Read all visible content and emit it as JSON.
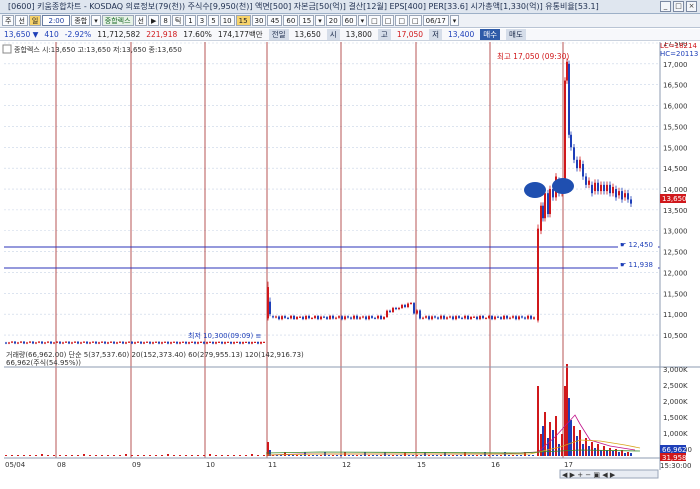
{
  "window": {
    "title": "[0600] 키움종합차트 - KOSDAQ 의료정보(79(천)) 주식수[9,950(천)] 액면[500] 자본금[50(억)] 결산[12월] EPS[400] PER[33.6] 시가총액[1,330(억)] 유통비율[53.1]",
    "buttons": [
      "_",
      "□",
      "×"
    ]
  },
  "toolbar": {
    "items": [
      "주",
      "선",
      "일",
      "종합",
      "▾",
      "중합렉스",
      "선",
      "▶",
      "8",
      "틱",
      "1",
      "3",
      "5",
      "10",
      "15",
      "30",
      "45",
      "60",
      "15",
      "▾",
      "20",
      "60",
      "▾",
      "",
      "",
      "",
      "",
      "06/17",
      "▾"
    ],
    "code_value": "2:00",
    "selected": "일"
  },
  "infobar": {
    "price": "13,650 ▼",
    "change": "410",
    "rate": "-2.92%",
    "volume": "11,712,582",
    "amount": "221,918",
    "pct": "17.60%",
    "trade_value": "174,177백만",
    "prev_label": "전일",
    "prev": "13,650",
    "open_label": "시",
    "open": "13,800",
    "high_label": "고",
    "high": "17,050",
    "low_label": "저",
    "low": "13,400",
    "buy": "매수",
    "sell": "매도"
  },
  "chart": {
    "legend_price": "종합렉스 시:13,650 고:13,650 저:13,650 종:13,650",
    "high_label": "최고 17,050 (09:30)",
    "low_label": "최저 10,300(09:09) ≡",
    "right_top_labels": [
      "LC=18214",
      "HC=20113"
    ],
    "price_ticks": [
      "17,500",
      "17,000",
      "16,500",
      "16,000",
      "15,500",
      "15,000",
      "14,500",
      "14,000",
      "13,500",
      "13,000",
      "12,500",
      "12,000",
      "11,500",
      "11,000",
      "10,500"
    ],
    "current_price_badge": "13,650",
    "hline1_label": "12,450",
    "hline2_label": "11,938",
    "volume_legend": "거래량(66,962.00)  단순 5(37,537.60) 20(152,373.40) 60(279,955.13) 120(142,916.73)",
    "volume_sub": "66,962(주식(54.95%))",
    "volume_ticks": [
      "3,000K",
      "2,500K",
      "2,000K",
      "1,500K",
      "1,000K",
      "500,000"
    ],
    "volume_badges": [
      "66,962",
      "31,958"
    ],
    "date_labels": [
      "05/04",
      "08",
      "09",
      "10",
      "11",
      "12",
      "15",
      "16",
      "17"
    ],
    "time_label": "15:30:00"
  },
  "colors": {
    "up": "#d0181b",
    "down": "#1e3fb8",
    "hline": "#2b33b8",
    "vline": "#a52a2a",
    "grid": "#c7d3e6",
    "ma5": "#c0128a",
    "ma20": "#d8a31a",
    "ma60": "#3a8a2a"
  }
}
